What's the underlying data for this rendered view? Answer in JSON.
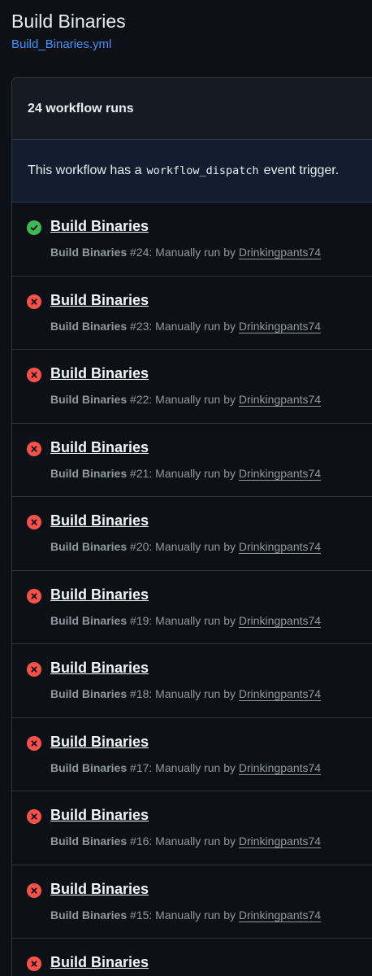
{
  "header": {
    "title": "Build Binaries",
    "workflow_file": "Build_Binaries.yml"
  },
  "runs": {
    "count_label": "24 workflow runs",
    "dispatch_banner": {
      "prefix": "This workflow has a",
      "code": "workflow_dispatch",
      "suffix": "event trigger."
    },
    "items": [
      {
        "status": "success",
        "icon": "check-circle-icon",
        "title": "Build Binaries",
        "workflow": "Build Binaries",
        "number": "#24",
        "event": ": Manually run by",
        "actor": "Drinkingpants74"
      },
      {
        "status": "failure",
        "icon": "x-circle-icon",
        "title": "Build Binaries",
        "workflow": "Build Binaries",
        "number": "#23",
        "event": ": Manually run by",
        "actor": "Drinkingpants74"
      },
      {
        "status": "failure",
        "icon": "x-circle-icon",
        "title": "Build Binaries",
        "workflow": "Build Binaries",
        "number": "#22",
        "event": ": Manually run by",
        "actor": "Drinkingpants74"
      },
      {
        "status": "failure",
        "icon": "x-circle-icon",
        "title": "Build Binaries",
        "workflow": "Build Binaries",
        "number": "#21",
        "event": ": Manually run by",
        "actor": "Drinkingpants74"
      },
      {
        "status": "failure",
        "icon": "x-circle-icon",
        "title": "Build Binaries",
        "workflow": "Build Binaries",
        "number": "#20",
        "event": ": Manually run by",
        "actor": "Drinkingpants74"
      },
      {
        "status": "failure",
        "icon": "x-circle-icon",
        "title": "Build Binaries",
        "workflow": "Build Binaries",
        "number": "#19",
        "event": ": Manually run by",
        "actor": "Drinkingpants74"
      },
      {
        "status": "failure",
        "icon": "x-circle-icon",
        "title": "Build Binaries",
        "workflow": "Build Binaries",
        "number": "#18",
        "event": ": Manually run by",
        "actor": "Drinkingpants74"
      },
      {
        "status": "failure",
        "icon": "x-circle-icon",
        "title": "Build Binaries",
        "workflow": "Build Binaries",
        "number": "#17",
        "event": ": Manually run by",
        "actor": "Drinkingpants74"
      },
      {
        "status": "failure",
        "icon": "x-circle-icon",
        "title": "Build Binaries",
        "workflow": "Build Binaries",
        "number": "#16",
        "event": ": Manually run by",
        "actor": "Drinkingpants74"
      },
      {
        "status": "failure",
        "icon": "x-circle-icon",
        "title": "Build Binaries",
        "workflow": "Build Binaries",
        "number": "#15",
        "event": ": Manually run by",
        "actor": "Drinkingpants74"
      },
      {
        "status": "failure",
        "icon": "x-circle-icon",
        "title": "Build Binaries",
        "workflow": "",
        "number": "",
        "event": "",
        "actor": ""
      }
    ]
  },
  "colors": {
    "background": "#0d1117",
    "link": "#4493f8",
    "success": "#3fb950",
    "failure": "#f85149",
    "muted_text": "#9198a1"
  }
}
